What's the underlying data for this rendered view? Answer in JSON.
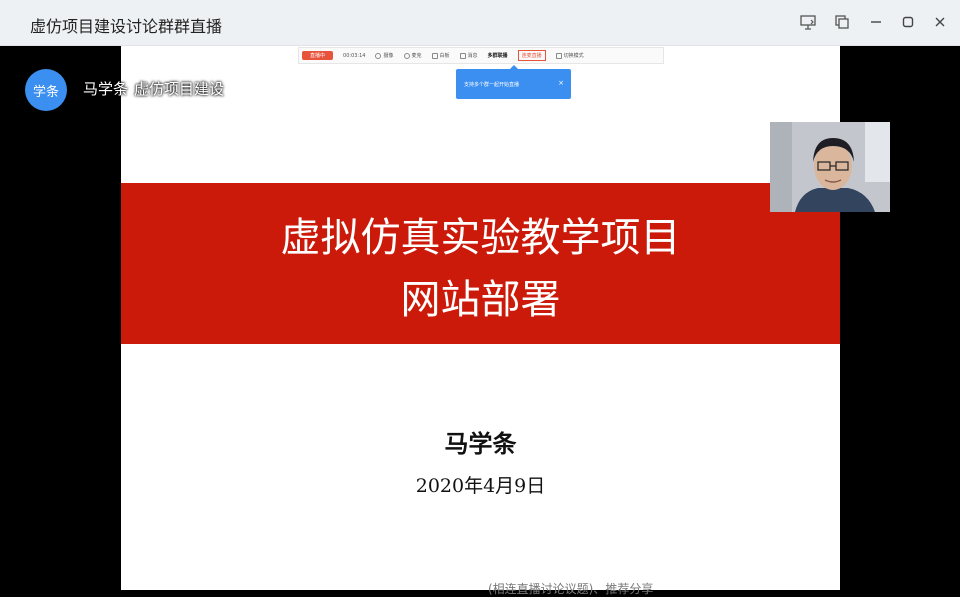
{
  "window": {
    "title": "虚仿项目建设讨论群群直播"
  },
  "toolbar": {
    "live_status": "直播中",
    "timer": "00:03:14",
    "items": [
      "摄像",
      "麦克",
      "白板",
      "消息",
      "多群联播"
    ],
    "connect_label": "连麦直播",
    "mode_label": "切换模式"
  },
  "tooltip": {
    "text": "支持多个群一起开始直播",
    "close": "×"
  },
  "host": {
    "avatar_text": "学条",
    "name": "马学条",
    "group": "虚仿项目建设"
  },
  "slide": {
    "title_line1": "虚拟仿真实验教学项目",
    "title_line2": "网站部署",
    "author": "马学条",
    "date": "2020年4月9日",
    "banner_color": "#cc1a0a"
  },
  "caption": {
    "text": "(相连直播讨论议题)、推荐分享"
  },
  "colors": {
    "accent_blue": "#3b8ff0",
    "live_red": "#e8533c"
  }
}
